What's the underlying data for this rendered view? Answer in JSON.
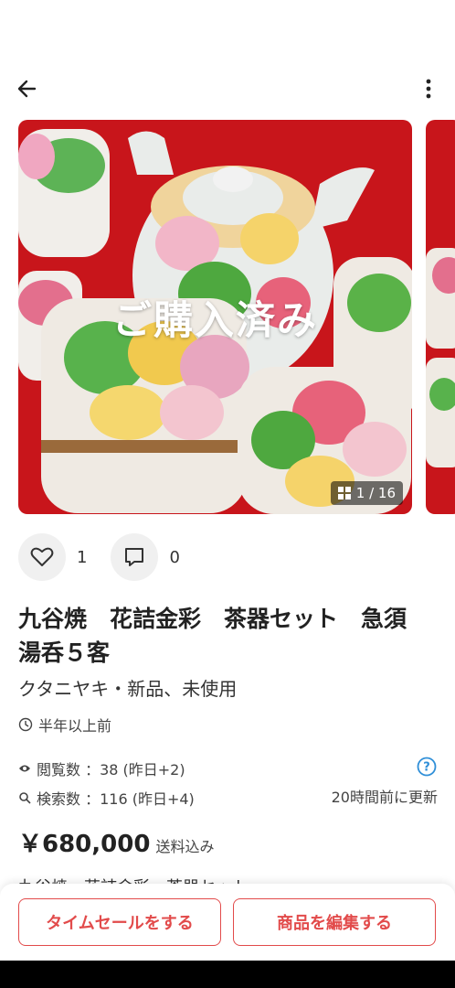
{
  "header": {
    "back_icon": "arrow-left-icon",
    "more_icon": "more-vertical-icon"
  },
  "gallery": {
    "overlay_text": "ご購入済み",
    "counter": "1 / 16",
    "counter_icon": "grid-icon",
    "main_colors": {
      "background": "#c8151b",
      "teapot": "#e9ecea"
    }
  },
  "actions": {
    "like_icon": "heart-icon",
    "like_count": "1",
    "comment_icon": "comment-icon",
    "comment_count": "0"
  },
  "item": {
    "title": "九谷焼　花詰金彩　茶器セット　急須　湯呑５客",
    "brand": "クタニヤキ・新品、未使用",
    "posted": "半年以上前",
    "views": "閲覧数 ：38 (昨日+2)",
    "searches": "検索数 ：116 (昨日+4)",
    "updated": "20時間前に更新",
    "price": "￥680,000",
    "shipping": "送料込み",
    "description_peek": "九谷焼　花詰金彩　茶器セット"
  },
  "bottom": {
    "timesale_label": "タイムセールをする",
    "edit_label": "商品を編集する",
    "accent": "#e24b4b"
  }
}
